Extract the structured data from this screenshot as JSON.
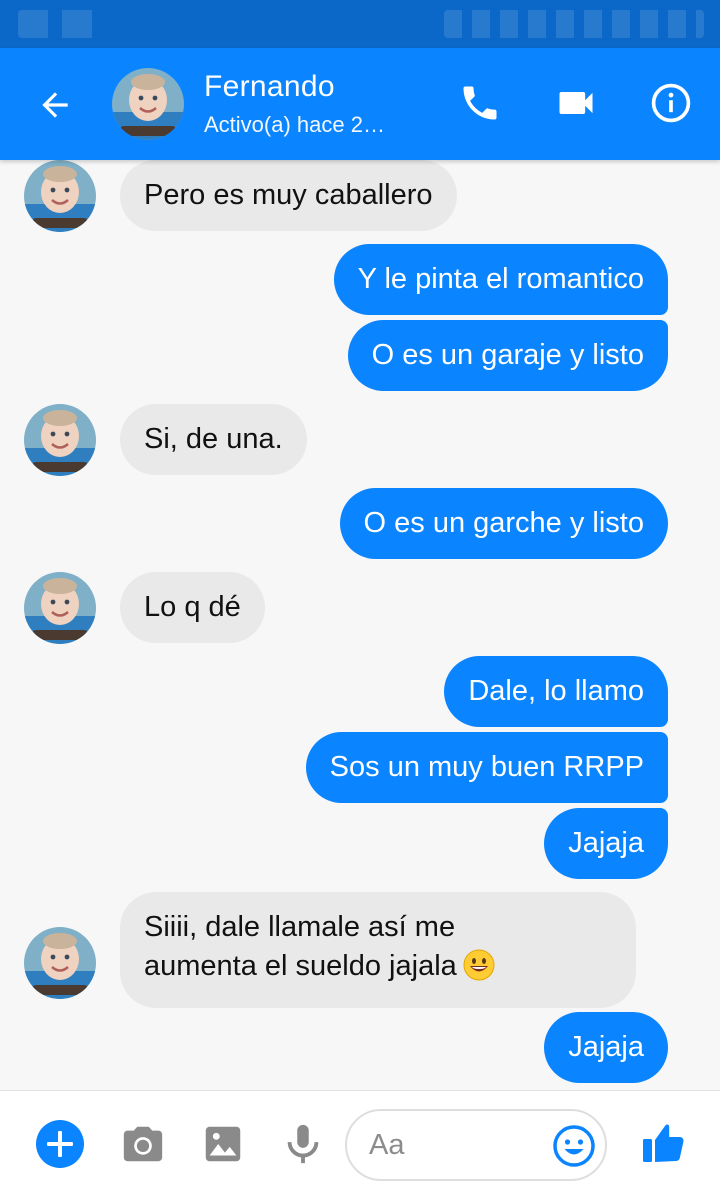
{
  "colors": {
    "accent": "#0a84ff",
    "status_bar": "#0b68c8",
    "incoming_bubble": "#e9e9e9",
    "background": "#f7f7f7"
  },
  "header": {
    "back_icon": "arrow-back-icon",
    "contact_name": "Fernando",
    "contact_status": "Activo(a) hace 2…",
    "call_icon": "phone-icon",
    "video_icon": "video-camera-icon",
    "info_icon": "info-icon"
  },
  "messages": [
    {
      "direction": "incoming",
      "text": "Pero es muy caballero"
    },
    {
      "direction": "outgoing",
      "text": "Y le pinta el romantico"
    },
    {
      "direction": "outgoing",
      "text": "O es un garaje y listo"
    },
    {
      "direction": "incoming",
      "text": "Si, de una."
    },
    {
      "direction": "outgoing",
      "text": "O es un garche y listo"
    },
    {
      "direction": "incoming",
      "text": "Lo q dé"
    },
    {
      "direction": "outgoing",
      "text": "Dale, lo llamo"
    },
    {
      "direction": "outgoing",
      "text": "Sos un muy buen RRPP"
    },
    {
      "direction": "outgoing",
      "text": "Jajaja"
    },
    {
      "direction": "incoming",
      "text_line1": "Siiii,  dale llamale así me",
      "text_line2": "aumenta el sueldo jajala",
      "emoji": "grinning-face-emoji"
    },
    {
      "direction": "outgoing",
      "text": "Jajaja"
    }
  ],
  "composer": {
    "placeholder": "Aa",
    "icons": [
      "plus-icon",
      "camera-icon",
      "image-icon",
      "microphone-icon",
      "smiley-icon",
      "thumbs-up-icon"
    ]
  }
}
